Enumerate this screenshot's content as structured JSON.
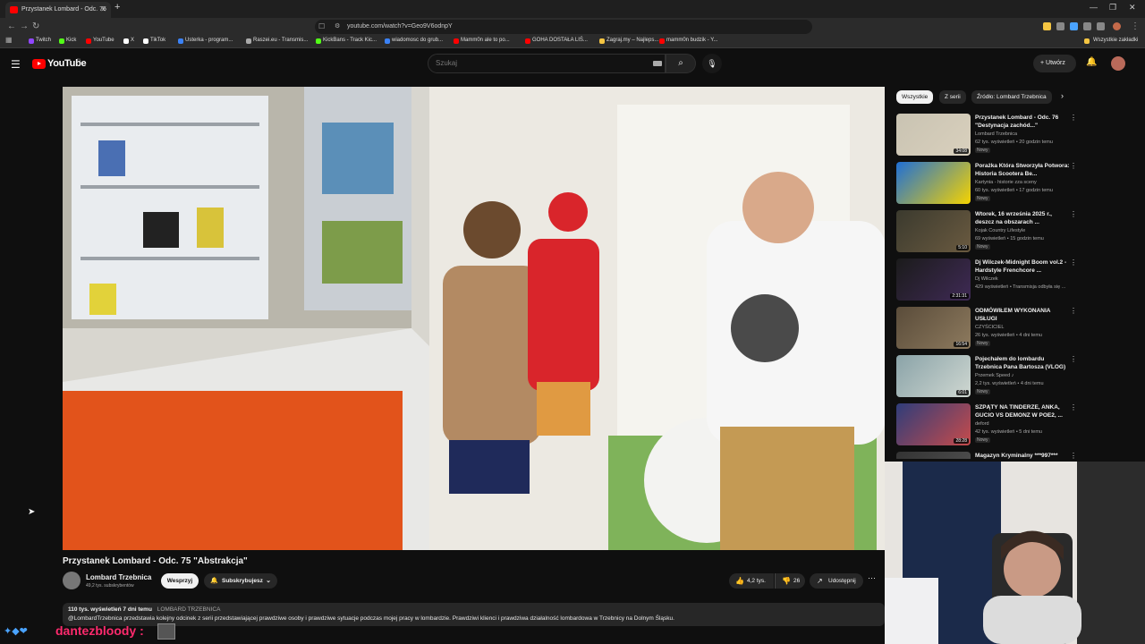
{
  "browser": {
    "tab_title": "Przystanek Lombard - Odc. 75",
    "url": "youtube.com/watch?v=Geo9V6odnpY",
    "bookmarks": [
      {
        "label": "Twitch",
        "color": "#9146ff"
      },
      {
        "label": "Kick",
        "color": "#53fc18"
      },
      {
        "label": "YouTube",
        "color": "#ff0000"
      },
      {
        "label": "X",
        "color": "#ffffff"
      },
      {
        "label": "TikTok",
        "color": "#ffffff"
      },
      {
        "label": "Usterka - program...",
        "color": "#3b82f6"
      },
      {
        "label": "Raszei.eu - Transmis...",
        "color": "#aaaaaa"
      },
      {
        "label": "KickBans - Track Kic...",
        "color": "#53fc18"
      },
      {
        "label": "wiadomosc do grub...",
        "color": "#3b82f6"
      },
      {
        "label": "Mamm0n ale to po...",
        "color": "#ff0000"
      },
      {
        "label": "GOHA DOSTAŁA LIŚ...",
        "color": "#ff0000"
      },
      {
        "label": "Zagraj.my – Najleps...",
        "color": "#f5c542"
      },
      {
        "label": "mamm0n budzik - Y...",
        "color": "#ff0000"
      }
    ],
    "all_bookmarks": "Wszystkie zakładki"
  },
  "youtube": {
    "logo_text": "YouTube",
    "country": "PL",
    "search_placeholder": "Szukaj",
    "create_label": "Utwórz"
  },
  "video": {
    "title": "Przystanek Lombard - Odc. 75 \"Abstrakcja\"",
    "channel": "Lombard Trzebnica",
    "subscribers": "49,2 tys. subskrybentów",
    "support_label": "Wesprzyj",
    "subscribed_label": "Subskrybujesz",
    "likes": "4,2 tys.",
    "dislikes": "26",
    "share_label": "Udostępnij",
    "views_date": "110 tys. wyświetleń  7 dni temu",
    "tag": "LOMBARD TRZEBNICA",
    "description": "@LombardTrzebnica przedstawia kolejny odcinek z serii przedstawiającej prawdziwe osoby i prawdziwe sytuacje podczas mojej pracy w lombardzie. Prawdziwi klienci i prawdziwa działalność lombardowa w Trzebnicy na Dolnym Śląsku."
  },
  "chips": [
    {
      "label": "Wszystkie",
      "active": true
    },
    {
      "label": "Z serii",
      "active": false
    },
    {
      "label": "Źródło: Lombard Trzebnica",
      "active": false
    }
  ],
  "recommendations": [
    {
      "title": "Przystanek Lombard - Odc. 76 \"Destynacja zachód...\"",
      "channel": "Lombard Trzebnica",
      "meta": "62 tys. wyświetleń • 20 godzin temu",
      "badge": "Nowy",
      "duration": "34:08",
      "colors": [
        "#c9c3b2",
        "#d9d0bd"
      ]
    },
    {
      "title": "Porażka Która Stworzyła Potwora: Historia Scootera Be...",
      "channel": "Kartynia - historie zza sceny",
      "meta": "60 tys. wyświetleń • 17 godzin temu",
      "badge": "Nowy",
      "duration": "",
      "colors": [
        "#1f6fd6",
        "#f5d300"
      ]
    },
    {
      "title": "Wtorek, 16 września 2025 r., deszcz na obszarach ...",
      "channel": "Kojak Country Lifestyle",
      "meta": "69 wyświetleń • 15 godzin temu",
      "badge": "Nowy",
      "duration": "5:10",
      "colors": [
        "#3b3a2e",
        "#6a5a40"
      ]
    },
    {
      "title": "Dj Wilczek-Midnight Boom vol.2 - Hardstyle Frenchcore ...",
      "channel": "Dj Wilczek",
      "meta": "429 wyświetleń • Transmisja odbyła się ...",
      "badge": "",
      "duration": "2:31:31",
      "colors": [
        "#1b1b1b",
        "#3f2a55"
      ]
    },
    {
      "title": "ODMÓWIŁEM WYKONANIA USŁUGI",
      "channel": "CZYŚCICIEL",
      "meta": "26 tys. wyświetleń • 4 dni temu",
      "badge": "Nowy",
      "duration": "16:54",
      "colors": [
        "#5a4c3a",
        "#8d7a5e"
      ]
    },
    {
      "title": "Pojechałem do lombardu Trzebnica Pana Bartosza (VLOG)",
      "channel": "Przemek Speed ♪",
      "meta": "2,2 tys. wyświetleń • 4 dni temu",
      "badge": "Nowy",
      "duration": "6:01",
      "colors": [
        "#8aa3a8",
        "#cfd7d1"
      ]
    },
    {
      "title": "SZPĄTY NA TINDERZE, ANKA, GUCIO VS DEMONZ W POE2, ...",
      "channel": "deford",
      "meta": "42 tys. wyświetleń • 5 dni temu",
      "badge": "Nowy",
      "duration": "28:28",
      "colors": [
        "#2f3d7a",
        "#c74b4b"
      ]
    },
    {
      "title": "Magazyn Kryminalny ***997***",
      "channel": "",
      "meta": "",
      "badge": "",
      "duration": "",
      "colors": [
        "#333333",
        "#555555"
      ]
    }
  ],
  "overlay": {
    "username": "dantezbloody",
    "separator": ":"
  }
}
